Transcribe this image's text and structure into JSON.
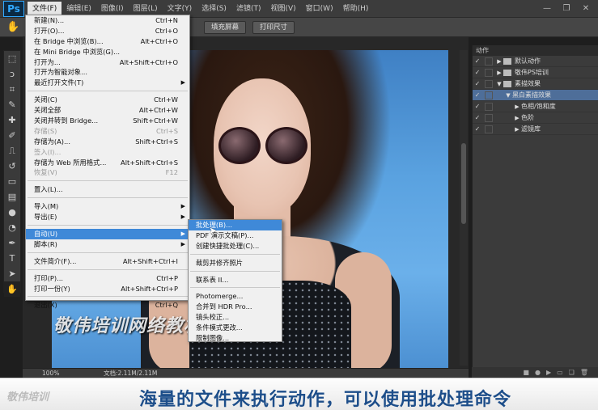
{
  "app": {
    "logo": "Ps"
  },
  "menubar": {
    "items": [
      "文件(F)",
      "编辑(E)",
      "图像(I)",
      "图层(L)",
      "文字(Y)",
      "选择(S)",
      "滤镜(T)",
      "视图(V)",
      "窗口(W)",
      "帮助(H)"
    ],
    "active_index": 0
  },
  "window_controls": {
    "minimize": "—",
    "restore": "❐",
    "close": "✕"
  },
  "options_bar": {
    "fill_screen": "填充屏幕",
    "print_size": "打印尺寸"
  },
  "file_menu": {
    "items": [
      {
        "label": "新建(N)...",
        "shortcut": "Ctrl+N"
      },
      {
        "label": "打开(O)...",
        "shortcut": "Ctrl+O"
      },
      {
        "label": "在 Bridge 中浏览(B)...",
        "shortcut": "Alt+Ctrl+O"
      },
      {
        "label": "在 Mini Bridge 中浏览(G)...",
        "shortcut": ""
      },
      {
        "label": "打开为...",
        "shortcut": "Alt+Shift+Ctrl+O"
      },
      {
        "label": "打开为智能对象...",
        "shortcut": ""
      },
      {
        "label": "最近打开文件(T)",
        "shortcut": "",
        "submenu": true
      },
      {
        "sep": true
      },
      {
        "label": "关闭(C)",
        "shortcut": "Ctrl+W"
      },
      {
        "label": "关闭全部",
        "shortcut": "Alt+Ctrl+W"
      },
      {
        "label": "关闭并转到 Bridge...",
        "shortcut": "Shift+Ctrl+W"
      },
      {
        "label": "存储(S)",
        "shortcut": "Ctrl+S",
        "disabled": true
      },
      {
        "label": "存储为(A)...",
        "shortcut": "Shift+Ctrl+S"
      },
      {
        "label": "签入(I)...",
        "shortcut": "",
        "disabled": true
      },
      {
        "label": "存储为 Web 所用格式...",
        "shortcut": "Alt+Shift+Ctrl+S"
      },
      {
        "label": "恢复(V)",
        "shortcut": "F12",
        "disabled": true
      },
      {
        "sep": true
      },
      {
        "label": "置入(L)...",
        "shortcut": ""
      },
      {
        "sep": true
      },
      {
        "label": "导入(M)",
        "shortcut": "",
        "submenu": true
      },
      {
        "label": "导出(E)",
        "shortcut": "",
        "submenu": true
      },
      {
        "sep": true
      },
      {
        "label": "自动(U)",
        "shortcut": "",
        "submenu": true,
        "highlighted": true
      },
      {
        "label": "脚本(R)",
        "shortcut": "",
        "submenu": true
      },
      {
        "sep": true
      },
      {
        "label": "文件简介(F)...",
        "shortcut": "Alt+Shift+Ctrl+I"
      },
      {
        "sep": true
      },
      {
        "label": "打印(P)...",
        "shortcut": "Ctrl+P"
      },
      {
        "label": "打印一份(Y)",
        "shortcut": "Alt+Shift+Ctrl+P"
      },
      {
        "sep": true
      },
      {
        "label": "退出(X)",
        "shortcut": "Ctrl+Q"
      }
    ]
  },
  "automate_submenu": {
    "items": [
      {
        "label": "批处理(B)...",
        "highlighted": true
      },
      {
        "label": "PDF 演示文稿(P)..."
      },
      {
        "label": "创建快捷批处理(C)..."
      },
      {
        "sep": true
      },
      {
        "label": "裁剪并修齐照片"
      },
      {
        "sep": true
      },
      {
        "label": "联系表 II..."
      },
      {
        "sep": true
      },
      {
        "label": "Photomerge..."
      },
      {
        "label": "合并到 HDR Pro..."
      },
      {
        "label": "镜头校正..."
      },
      {
        "label": "条件模式更改..."
      },
      {
        "label": "限制图像..."
      }
    ]
  },
  "actions_panel": {
    "title": "动作",
    "rows": [
      {
        "label": "默认动作",
        "indent": 0,
        "expanded": false
      },
      {
        "label": "敬伟PS培训",
        "indent": 0,
        "expanded": false
      },
      {
        "label": "素描效果",
        "indent": 0,
        "expanded": true
      },
      {
        "label": "黑白素描效果",
        "indent": 1,
        "expanded": true,
        "selected": true
      },
      {
        "label": "色相/饱和度",
        "indent": 2,
        "expanded": false
      },
      {
        "label": "色阶",
        "indent": 2,
        "expanded": false
      },
      {
        "label": "滤镜库",
        "indent": 2,
        "expanded": false
      }
    ]
  },
  "status": {
    "zoom": "100%",
    "doc": "文档:2.11M/2.11M"
  },
  "watermark": "敬伟培训网络教材",
  "caption": {
    "logo": "敬伟培训",
    "text": "海量的文件来执行动作，可以使用批处理命令"
  }
}
